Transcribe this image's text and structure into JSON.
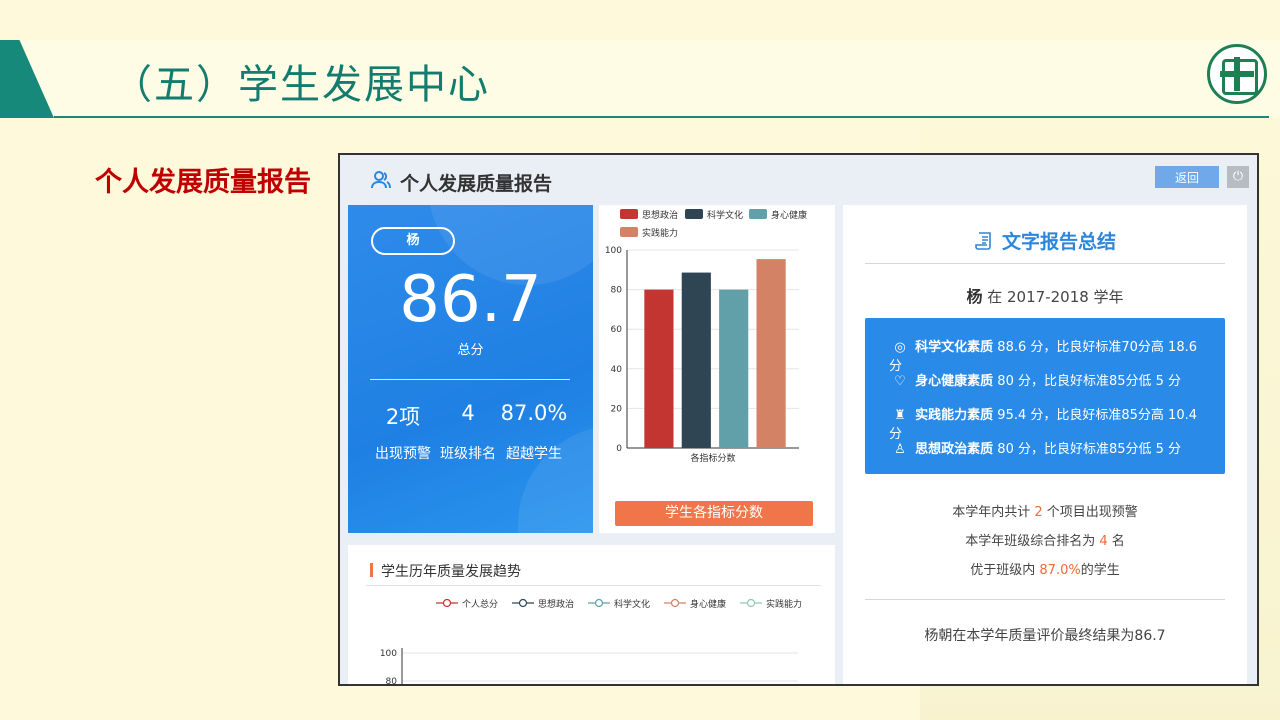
{
  "slide": {
    "title": "（五）学生发展中心",
    "section_label": "个人发展质量报告"
  },
  "app": {
    "page_title": "个人发展质量报告",
    "back_label": "返回",
    "power_icon": "power-icon"
  },
  "score_card": {
    "student_name": "杨",
    "total_score": "86.7",
    "total_label": "总分",
    "stats": [
      {
        "value": "2项",
        "label": "出现预警"
      },
      {
        "value": "4",
        "label": "班级排名"
      },
      {
        "value": "87.0%",
        "label": "超越学生"
      }
    ]
  },
  "chart_data": [
    {
      "type": "bar",
      "title": "",
      "xlabel": "各指标分数",
      "ylabel": "",
      "ylim": [
        0,
        100
      ],
      "yticks": [
        0,
        20,
        40,
        60,
        80,
        100
      ],
      "legend_position": "top",
      "series": [
        {
          "name": "思想政治",
          "color": "#c23531",
          "values": [
            80
          ]
        },
        {
          "name": "科学文化",
          "color": "#2f4554",
          "values": [
            88.6
          ]
        },
        {
          "name": "身心健康",
          "color": "#61a0a8",
          "values": [
            80
          ]
        },
        {
          "name": "实践能力",
          "color": "#d48265",
          "values": [
            95.4
          ]
        }
      ],
      "button_label": "学生各指标分数"
    },
    {
      "type": "line",
      "title": "学生历年质量发展趋势",
      "xlabel": "",
      "ylabel": "",
      "ylim": [
        80,
        100
      ],
      "yticks": [
        80,
        100
      ],
      "legend_position": "top",
      "series": [
        {
          "name": "个人总分",
          "color": "#c23531"
        },
        {
          "name": "思想政治",
          "color": "#2f4554"
        },
        {
          "name": "科学文化",
          "color": "#61a0a8"
        },
        {
          "name": "身心健康",
          "color": "#d48265"
        },
        {
          "name": "实践能力",
          "color": "#91c7ae"
        }
      ]
    }
  ],
  "report": {
    "title": "文字报告总结",
    "year_name": "杨",
    "year_text": "在 2017-2018 学年",
    "items": [
      {
        "icon": "planet-icon",
        "name": "科学文化素质",
        "text": "88.6 分，比良好标准70分高 18.6 分"
      },
      {
        "icon": "heart-icon",
        "name": "身心健康素质",
        "text": "80 分，比良好标准85分低 5 分"
      },
      {
        "icon": "trophy-icon",
        "name": "实践能力素质",
        "text": "95.4 分，比良好标准85分高 10.4 分"
      },
      {
        "icon": "badge-icon",
        "name": "思想政治素质",
        "text": "80 分，比良好标准85分低 5 分"
      }
    ],
    "warn_pre": "本学年内共计 ",
    "warn_num": "2",
    "warn_post": " 个项目出现预警",
    "rank_pre": "本学年班级综合排名为 ",
    "rank_num": "4",
    "rank_post": " 名",
    "beat_pre": "优于班级内 ",
    "beat_num": "87.0%",
    "beat_post": "的学生",
    "final": "杨朝在本学年质量评价最终结果为86.7"
  }
}
